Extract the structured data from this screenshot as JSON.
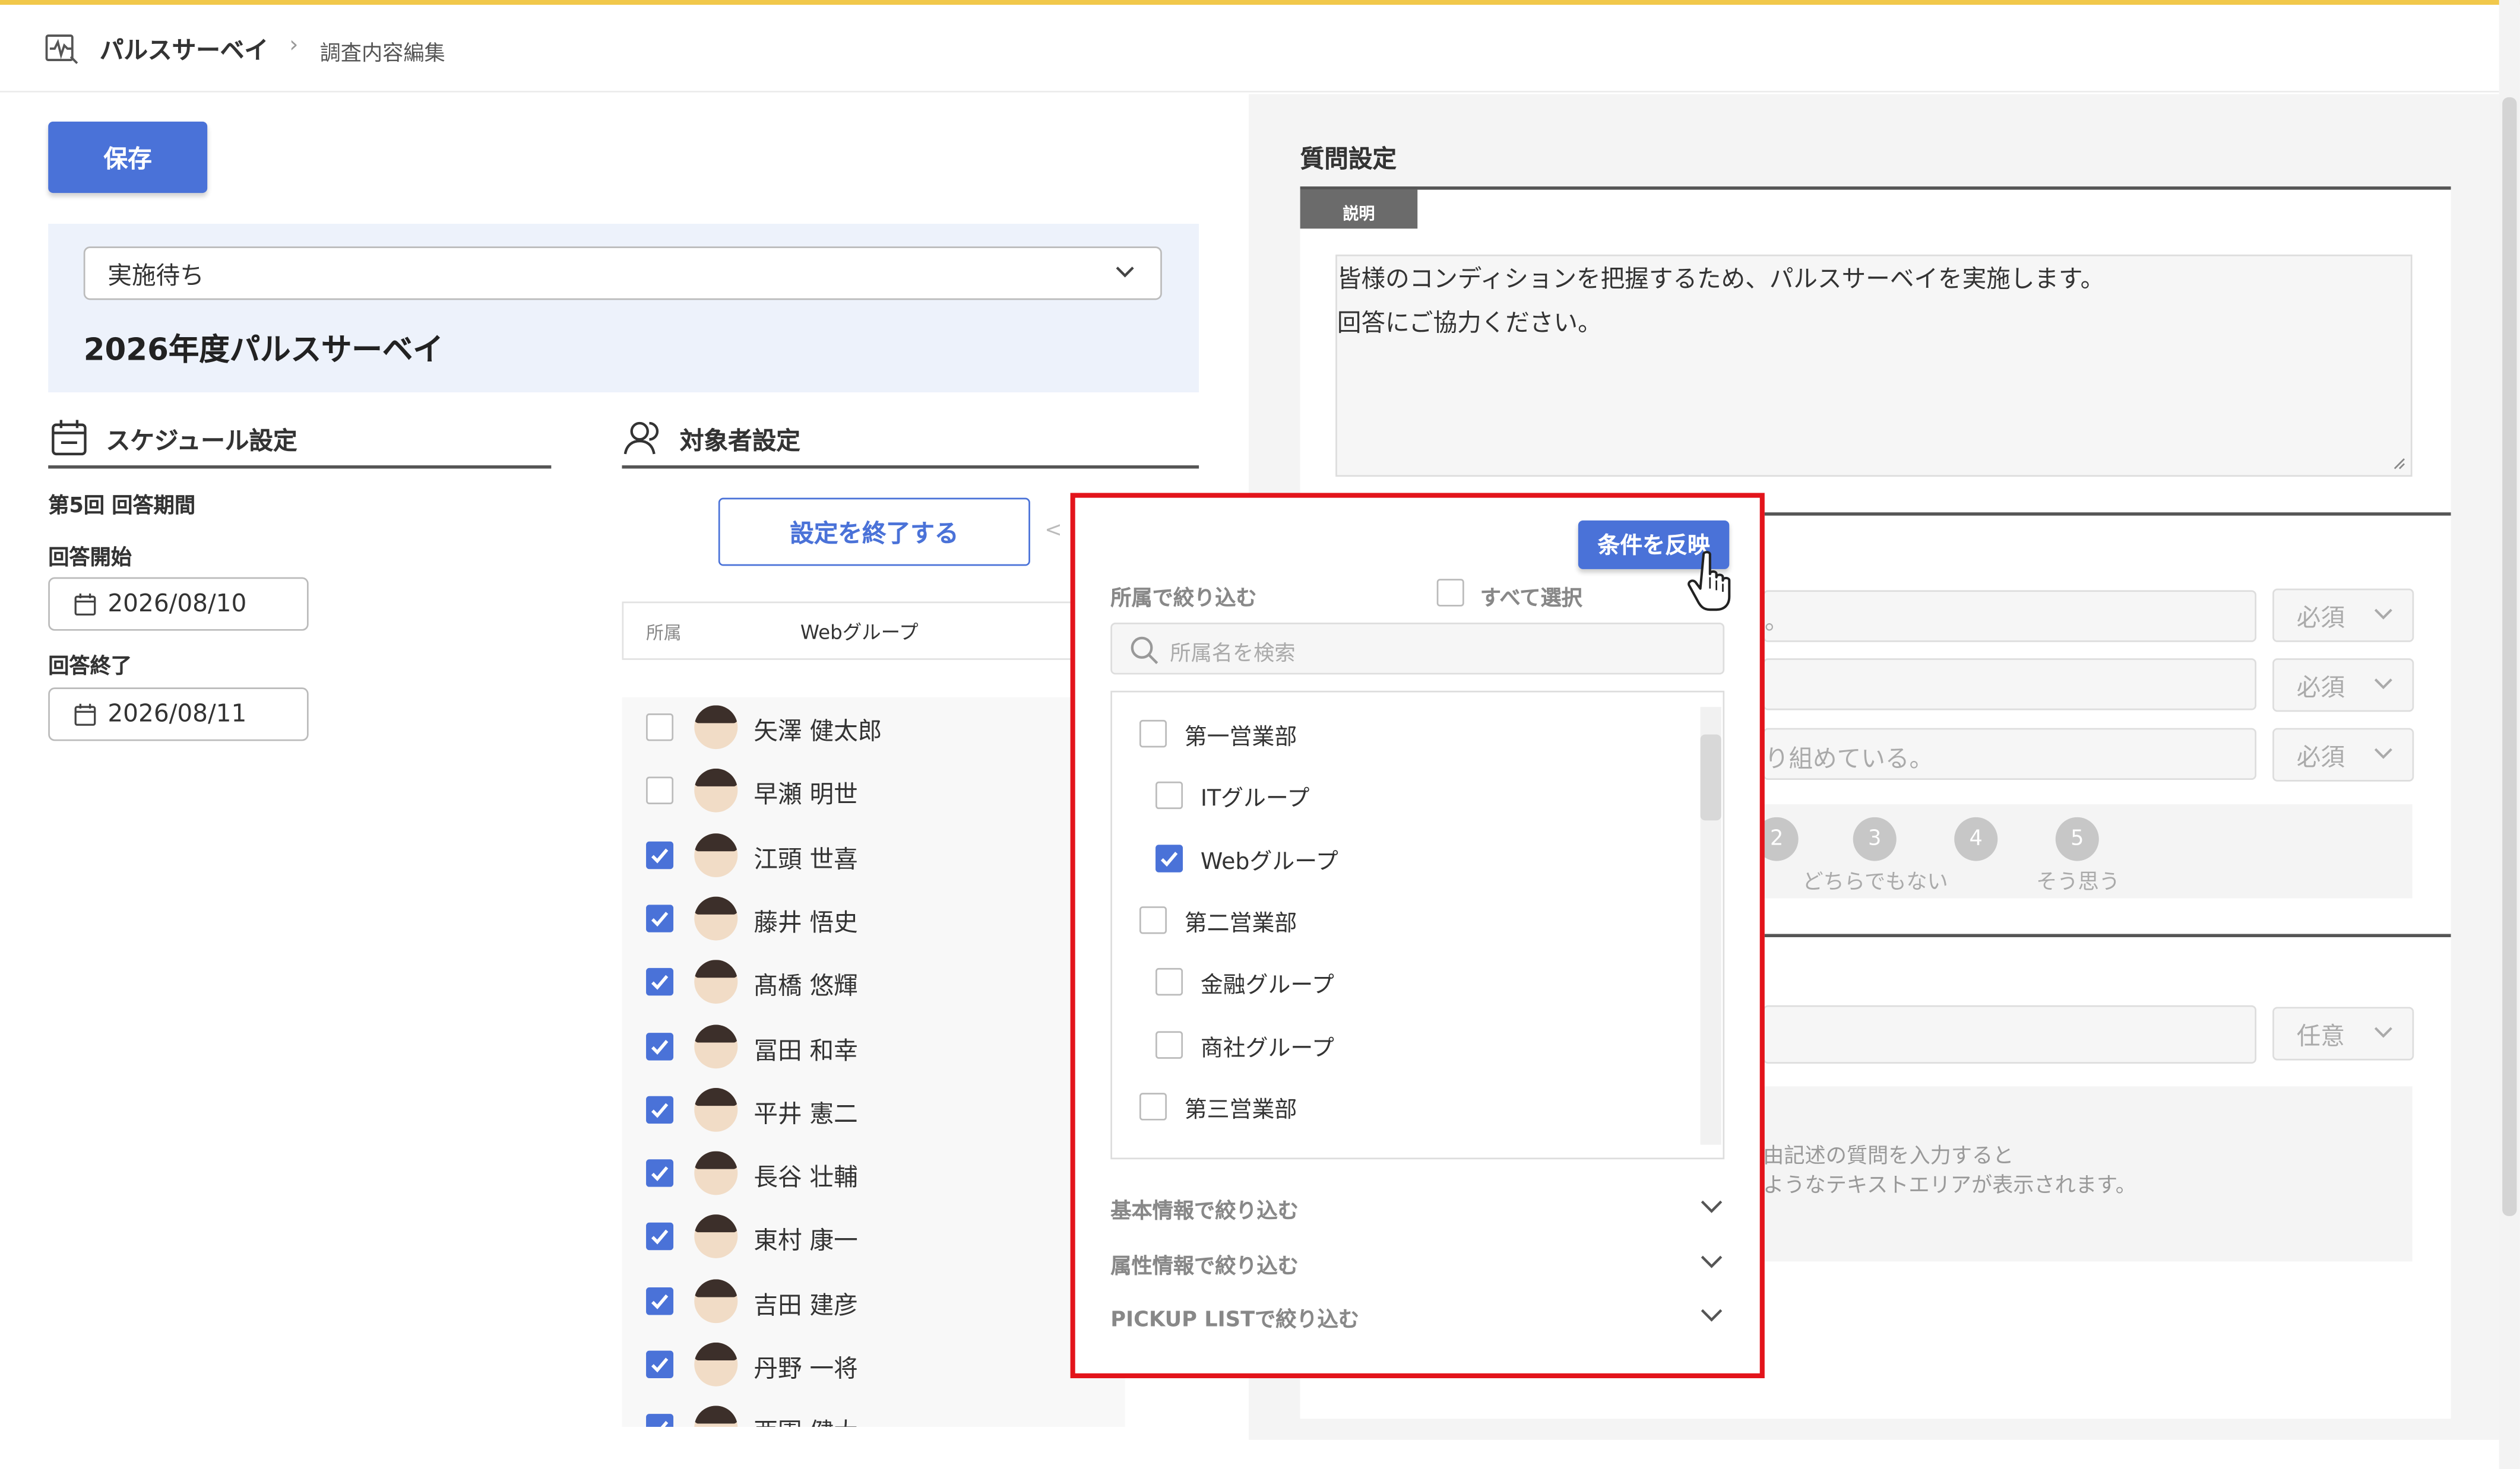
{
  "header": {
    "app_title": "パルスサーベイ",
    "separator": "›",
    "page_title": "調査内容編集"
  },
  "toolbar": {
    "save_label": "保存"
  },
  "survey": {
    "status": "実施待ち",
    "title": "2026年度パルスサーベイ"
  },
  "schedule": {
    "section_title": "スケジュール設定",
    "period_label": "第5回 回答期間",
    "start_label": "回答開始",
    "start_date": "2026/08/10",
    "end_label": "回答終了",
    "end_date": "2026/08/11"
  },
  "targets": {
    "section_title": "対象者設定",
    "end_button": "設定を終了する",
    "filter_label": "所属",
    "filter_value": "Webグループ",
    "members": [
      {
        "name": "矢澤 健太郎",
        "checked": false
      },
      {
        "name": "早瀬 明世",
        "checked": false
      },
      {
        "name": "江頭 世喜",
        "checked": true
      },
      {
        "name": "藤井 悟史",
        "checked": true
      },
      {
        "name": "髙橋 悠輝",
        "checked": true
      },
      {
        "name": "冨田 和幸",
        "checked": true
      },
      {
        "name": "平井 憲二",
        "checked": true
      },
      {
        "name": "長谷 壮輔",
        "checked": true
      },
      {
        "name": "東村 康一",
        "checked": true
      },
      {
        "name": "吉田 建彦",
        "checked": true
      },
      {
        "name": "丹野 一将",
        "checked": true
      },
      {
        "name": "西園 健大",
        "checked": true
      }
    ]
  },
  "questions": {
    "section_title": "質問設定",
    "desc_tag": "説明",
    "description_line1": "皆様のコンディションを把握するため、パルスサーベイを実施します。",
    "description_line2": "回答にご協力ください。",
    "q1_fragment": "。",
    "q3_fragment": "り組めている。",
    "required_label": "必須",
    "optional_label": "任意",
    "scale": [
      {
        "num": "2",
        "label": ""
      },
      {
        "num": "3",
        "label": "どちらでもない"
      },
      {
        "num": "4",
        "label": ""
      },
      {
        "num": "5",
        "label": "そう思う"
      }
    ],
    "free_line1": "由記述の質問を入力すると",
    "free_line2": "ようなテキストエリアが表示されます。"
  },
  "popup": {
    "apply_button": "条件を反映",
    "dept_filter_label": "所属で絞り込む",
    "select_all_label": "すべて選択",
    "search_placeholder": "所属名を検索",
    "departments": [
      {
        "label": "第一営業部",
        "level": 0,
        "checked": false
      },
      {
        "label": "ITグループ",
        "level": 1,
        "checked": false
      },
      {
        "label": "Webグループ",
        "level": 1,
        "checked": true
      },
      {
        "label": "第二営業部",
        "level": 0,
        "checked": false
      },
      {
        "label": "金融グループ",
        "level": 1,
        "checked": false
      },
      {
        "label": "商社グループ",
        "level": 1,
        "checked": false
      },
      {
        "label": "第三営業部",
        "level": 0,
        "checked": false
      }
    ],
    "accordions": [
      "基本情報で絞り込む",
      "属性情報で絞り込む",
      "PICKUP LISTで絞り込む"
    ]
  },
  "colors": {
    "accent": "#4a72d8",
    "highlight_border": "#e3141b",
    "top_line": "#f1c84b"
  }
}
